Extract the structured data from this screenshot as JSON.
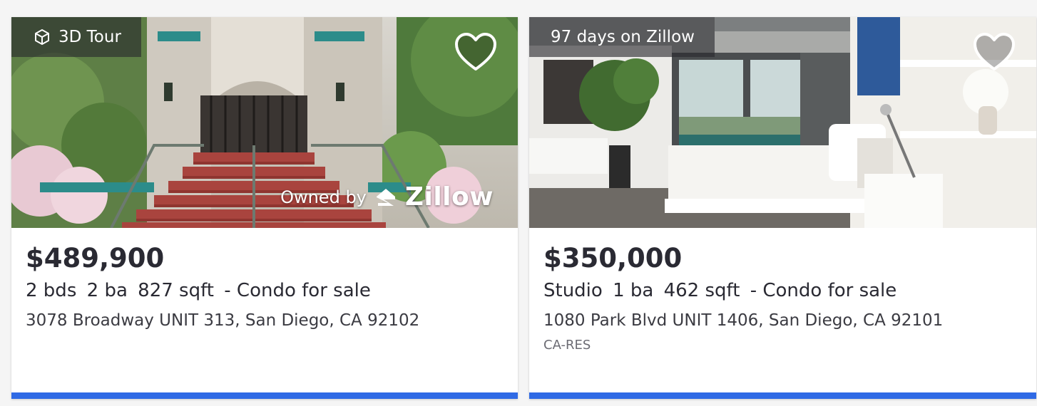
{
  "listings": [
    {
      "badge": "3D Tour",
      "badge_icon": "cube-icon",
      "owned_text": "Owned by",
      "owned_brand": "Zillow",
      "price": "$489,900",
      "beds": "2 bds",
      "baths": "2 ba",
      "sqft": "827 sqft",
      "type": "- Condo for sale",
      "address": "3078 Broadway UNIT 313, San Diego, CA 92102",
      "mls": ""
    },
    {
      "badge": "97 days on Zillow",
      "price": "$350,000",
      "beds": "Studio",
      "baths": "1 ba",
      "sqft": "462 sqft",
      "type": "- Condo for sale",
      "address": "1080 Park Blvd UNIT 1406, San Diego, CA 92101",
      "mls": "CA-RES"
    }
  ],
  "colors": {
    "accent_bar": "#2f6ae5",
    "price_text": "#2a2a33",
    "badge_bg": "rgba(40,40,45,0.62)"
  }
}
